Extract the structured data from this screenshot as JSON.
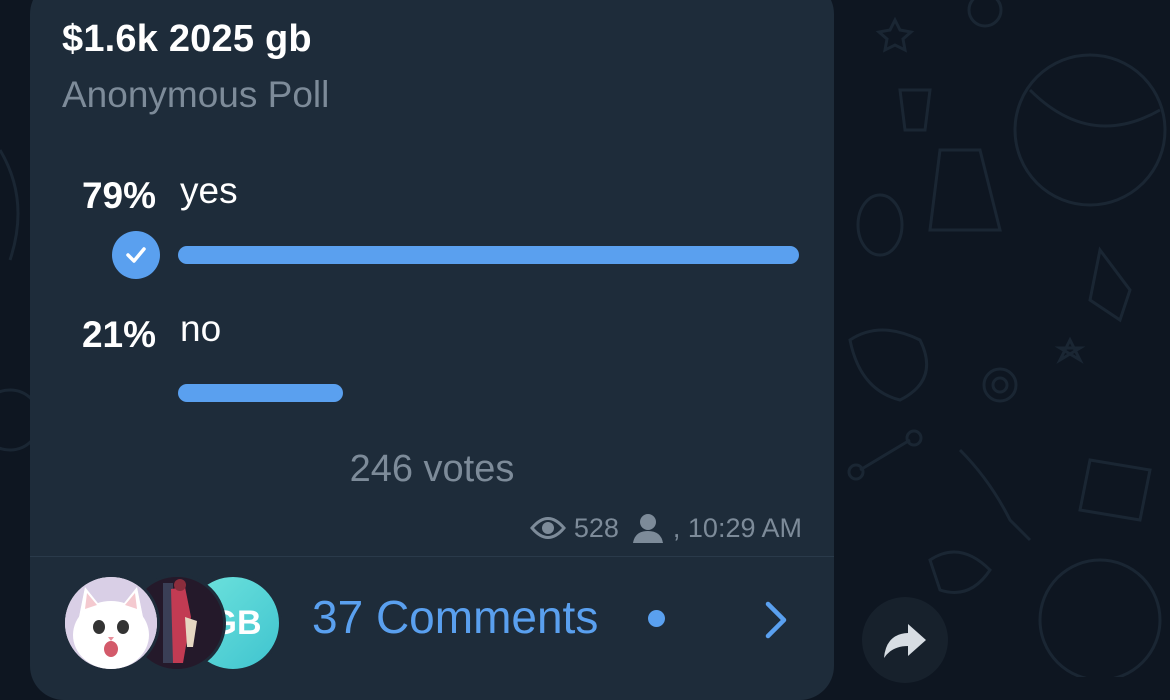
{
  "poll": {
    "title": "$1.6k 2025 gb",
    "type_label": "Anonymous Poll",
    "options": [
      {
        "percent_label": "79%",
        "label": "yes",
        "fraction": 0.79,
        "selected": true
      },
      {
        "percent_label": "21%",
        "label": "no",
        "fraction": 0.21,
        "selected": false
      }
    ],
    "total_votes": "246 votes"
  },
  "meta": {
    "views": "528",
    "time": ", 10:29 AM"
  },
  "comments": {
    "label": "37 Comments",
    "avatar_initials": "GB"
  },
  "colors": {
    "accent": "#5aa0ef",
    "bubble": "#1e2c3a",
    "background": "#0e1621",
    "secondary_text": "#7d8b99"
  },
  "icons": [
    "check-icon",
    "eye-icon",
    "person-icon",
    "chevron-right-icon",
    "share-arrow-icon"
  ]
}
